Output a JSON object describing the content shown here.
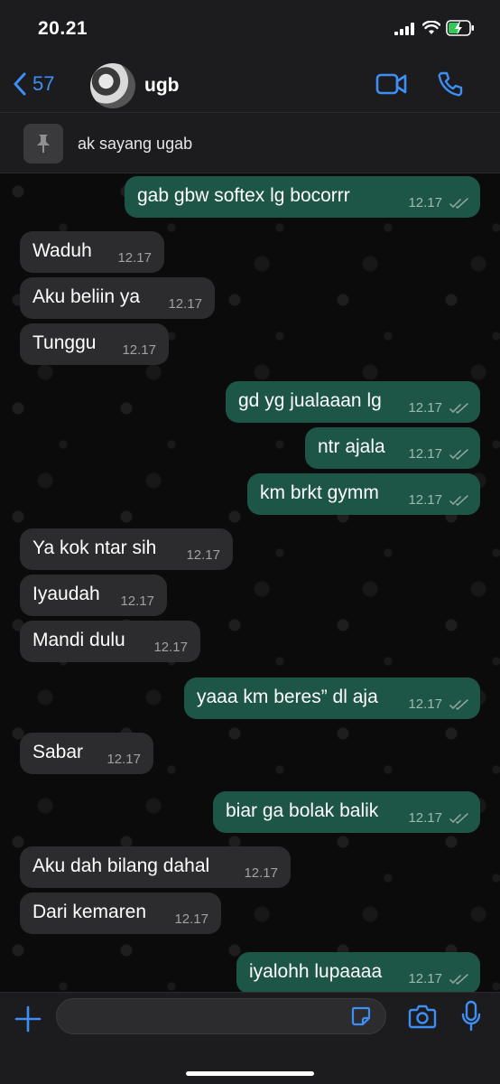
{
  "status_bar": {
    "time": "20.21"
  },
  "header": {
    "back_count": "57",
    "contact_name": "ugb"
  },
  "pinned": {
    "text": "ak sayang ugab"
  },
  "messages": [
    {
      "dir": "out",
      "text": "gab gbw softex lg bocorrr",
      "time": "12.17"
    },
    {
      "dir": "in",
      "text": "Waduh",
      "time": "12.17"
    },
    {
      "dir": "in",
      "text": "Aku beliin ya",
      "time": "12.17"
    },
    {
      "dir": "in",
      "text": "Tunggu",
      "time": "12.17"
    },
    {
      "dir": "out",
      "text": "gd yg jualaaan lg",
      "time": "12.17"
    },
    {
      "dir": "out",
      "text": "ntr ajala",
      "time": "12.17"
    },
    {
      "dir": "out",
      "text": "km brkt gymm",
      "time": "12.17"
    },
    {
      "dir": "in",
      "text": "Ya kok ntar sih",
      "time": "12.17"
    },
    {
      "dir": "in",
      "text": "Iyaudah",
      "time": "12.17"
    },
    {
      "dir": "in",
      "text": "Mandi dulu",
      "time": "12.17"
    },
    {
      "dir": "out",
      "text": "yaaa km beres” dl aja",
      "time": "12.17"
    },
    {
      "dir": "in",
      "text": "Sabar",
      "time": "12.17"
    },
    {
      "dir": "out",
      "text": "biar ga bolak balik",
      "time": "12.17"
    },
    {
      "dir": "in",
      "text": "Aku dah bilang dahal",
      "time": "12.17"
    },
    {
      "dir": "in",
      "text": "Dari kemaren",
      "time": "12.17"
    },
    {
      "dir": "out",
      "text": "iyalohh lupaaaa",
      "time": "12.17"
    }
  ],
  "input": {
    "placeholder": ""
  },
  "colors": {
    "accent": "#3d8ef5",
    "outgoing_bubble": "#1d5646",
    "incoming_bubble": "#2c2c2e",
    "read_ticks": "#8aa39b"
  },
  "icons": [
    "back-chevron-icon",
    "video-call-icon",
    "phone-icon",
    "pin-icon",
    "double-check-icon",
    "chevron-down-icon",
    "plus-icon",
    "sticker-icon",
    "camera-icon",
    "microphone-icon"
  ]
}
